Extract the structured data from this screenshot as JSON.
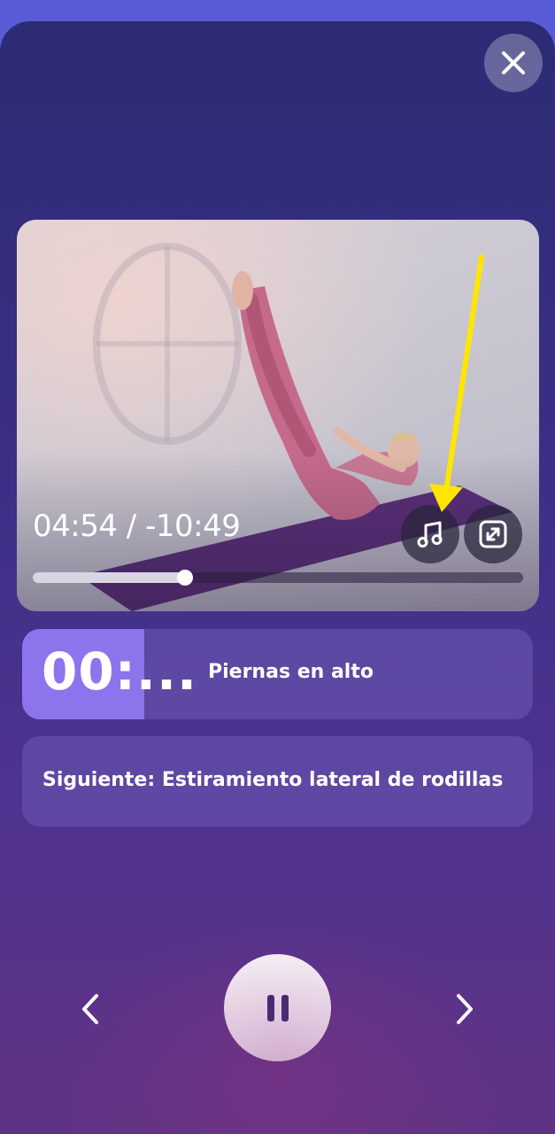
{
  "player": {
    "elapsed": "04:54",
    "separator": "/",
    "remaining": "-10:49",
    "progress_fraction": 0.31
  },
  "exercise": {
    "timer": "00:...",
    "name": "Piernas en alto",
    "timer_fill_fraction": 0.24
  },
  "next": {
    "label": "Siguiente: Estiramiento lateral de rodillas"
  },
  "icons": {
    "close": "close-icon",
    "music": "music-note-icon",
    "fullscreen": "expand-icon",
    "prev": "chevron-left-icon",
    "pause": "pause-icon",
    "next": "chevron-right-icon"
  },
  "colors": {
    "accent": "#8d74ec",
    "annotation_arrow": "#ffe600"
  }
}
